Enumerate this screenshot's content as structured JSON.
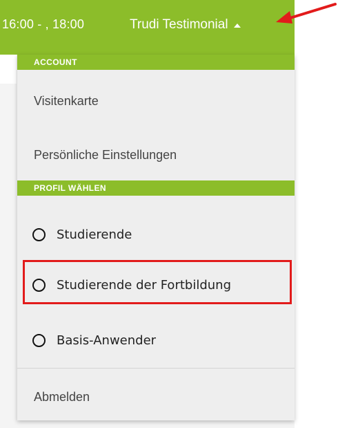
{
  "header": {
    "time_range": "16:00 - , 18:00",
    "user_name": "Trudi Testimonial",
    "caret_icon": "caret-up-icon"
  },
  "dropdown": {
    "account_header": "ACCOUNT",
    "account_items": [
      {
        "label": "Visitenkarte"
      },
      {
        "label": "Persönliche Einstellungen"
      }
    ],
    "profile_header": "PROFIL WÄHLEN",
    "profiles": [
      {
        "label": "Studierende",
        "selected": false
      },
      {
        "label": "Studierende der Fortbildung",
        "selected": false
      },
      {
        "label": "Basis-Anwender",
        "selected": false
      }
    ],
    "logout_label": "Abmelden"
  },
  "colors": {
    "brand_green": "#8cbd2a",
    "annotation_red": "#e21b1b",
    "menu_background": "#eeeeee"
  }
}
